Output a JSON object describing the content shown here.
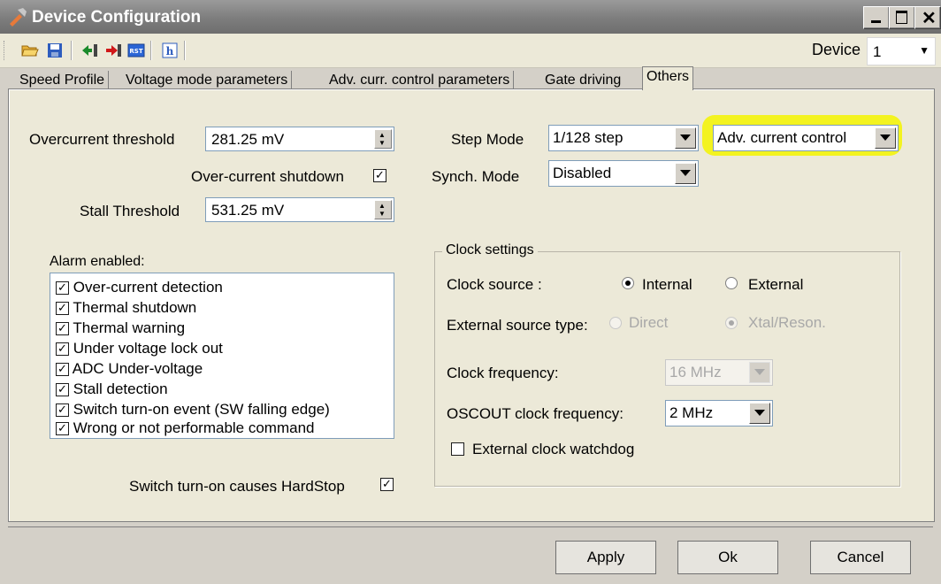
{
  "window": {
    "title": "Device Configuration"
  },
  "toolbar": {
    "icons": [
      "open-folder-icon",
      "save-icon",
      "connect-icon",
      "disconnect-icon",
      "reset-icon",
      "help-icon"
    ],
    "device_label": "Device",
    "device_value": "1"
  },
  "tabs": [
    "Speed Profile",
    "Voltage mode parameters",
    "Adv. curr. control parameters",
    "Gate driving",
    "Others"
  ],
  "active_tab": "Others",
  "others": {
    "overcurrent_label": "Overcurrent threshold",
    "overcurrent_value": "281.25 mV",
    "ocd_shutdown_label": "Over-current shutdown",
    "stall_label": "Stall Threshold",
    "stall_value": "531.25 mV",
    "alarm_label": "Alarm enabled:",
    "alarms": [
      "Over-current detection",
      "Thermal shutdown",
      "Thermal warning",
      "Under voltage lock out",
      "ADC Under-voltage",
      "Stall detection",
      "Switch turn-on event (SW falling edge)",
      "Wrong or not performable command"
    ],
    "hardstop_label": "Switch turn-on causes HardStop",
    "step_mode_label": "Step Mode",
    "step_mode_value": "1/128 step",
    "control_mode_value": "Adv. current control",
    "synch_mode_label": "Synch. Mode",
    "synch_mode_value": "Disabled"
  },
  "clock": {
    "group_label": "Clock settings",
    "source_label": "Clock source :",
    "internal_label": "Internal",
    "external_label": "External",
    "ext_type_label": "External source type:",
    "direct_label": "Direct",
    "xtal_label": "Xtal/Reson.",
    "freq_label": "Clock frequency:",
    "freq_value": "16 MHz",
    "oscout_label": "OSCOUT clock frequency:",
    "oscout_value": "2 MHz",
    "watchdog_label": "External clock watchdog"
  },
  "buttons": {
    "apply": "Apply",
    "ok": "Ok",
    "cancel": "Cancel"
  },
  "colors": {
    "highlight": "#f5f500"
  }
}
